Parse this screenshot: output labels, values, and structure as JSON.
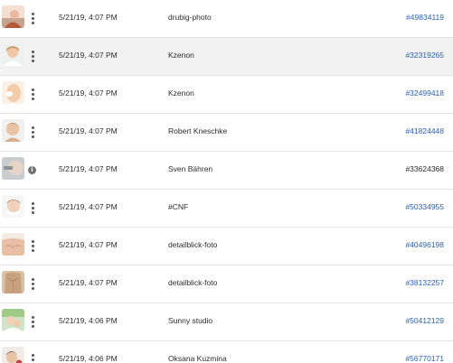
{
  "colors": {
    "link": "#2a5fb6",
    "row_highlight": "#f2f2f2",
    "divider": "#e6e6e6"
  },
  "rows": [
    {
      "thumb_icon": "photo-thumbnail",
      "action_icon": "more-vertical-icon",
      "date": "5/21/19, 4:07 PM",
      "author": "drubig-photo",
      "asset_id": "#49834119",
      "asset_id_is_link": true
    },
    {
      "thumb_icon": "photo-thumbnail",
      "action_icon": "more-vertical-icon",
      "date": "5/21/19, 4:07 PM",
      "author": "Kzenon",
      "asset_id": "#32319265",
      "asset_id_is_link": true,
      "highlighted": true
    },
    {
      "thumb_icon": "photo-thumbnail",
      "action_icon": "more-vertical-icon",
      "date": "5/21/19, 4:07 PM",
      "author": "Kzenon",
      "asset_id": "#32499418",
      "asset_id_is_link": true
    },
    {
      "thumb_icon": "photo-thumbnail",
      "action_icon": "more-vertical-icon",
      "date": "5/21/19, 4:07 PM",
      "author": "Robert Kneschke",
      "asset_id": "#41824448",
      "asset_id_is_link": true
    },
    {
      "thumb_icon": "photo-thumbnail",
      "action_icon": "info-icon",
      "date": "5/21/19, 4:07 PM",
      "author": "Sven Bähren",
      "asset_id": "#33624368",
      "asset_id_is_link": false
    },
    {
      "thumb_icon": "photo-thumbnail",
      "action_icon": "more-vertical-icon",
      "date": "5/21/19, 4:07 PM",
      "author": "#CNF",
      "asset_id": "#50334955",
      "asset_id_is_link": true
    },
    {
      "thumb_icon": "photo-thumbnail",
      "action_icon": "more-vertical-icon",
      "date": "5/21/19, 4:07 PM",
      "author": "detailblick-foto",
      "asset_id": "#40496198",
      "asset_id_is_link": true
    },
    {
      "thumb_icon": "photo-thumbnail",
      "action_icon": "more-vertical-icon",
      "date": "5/21/19, 4:07 PM",
      "author": "detailblick-foto",
      "asset_id": "#38132257",
      "asset_id_is_link": true
    },
    {
      "thumb_icon": "photo-thumbnail",
      "action_icon": "more-vertical-icon",
      "date": "5/21/19, 4:06 PM",
      "author": "Sunny studio",
      "asset_id": "#50412129",
      "asset_id_is_link": true
    },
    {
      "thumb_icon": "photo-thumbnail",
      "action_icon": "more-vertical-icon",
      "date": "5/21/19, 4:06 PM",
      "author": "Oksana Kuzmina",
      "asset_id": "#56770171",
      "asset_id_is_link": true
    }
  ]
}
